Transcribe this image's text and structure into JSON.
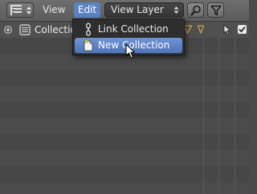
{
  "header": {
    "editor_type_icon": "outliner-icon",
    "menus": [
      {
        "label": "View"
      },
      {
        "label": "Edit"
      }
    ],
    "view_layer_dropdown": "View Layer",
    "search_icon": "search-icon",
    "filter_icon": "filter-icon"
  },
  "outliner": {
    "rows": [
      {
        "label": "Collection",
        "icon": "collection-icon"
      }
    ]
  },
  "dropdown_menu": {
    "items": [
      {
        "label": "Link Collection",
        "icon": "link-icon"
      },
      {
        "label": "New Collection",
        "icon": "new-collection-icon",
        "highlighted": true
      }
    ]
  },
  "colors": {
    "accent": "#5d82c4",
    "highlight": "#6f93d6",
    "background": "#4a4a4a",
    "menu_bg": "#2e2e2e"
  }
}
